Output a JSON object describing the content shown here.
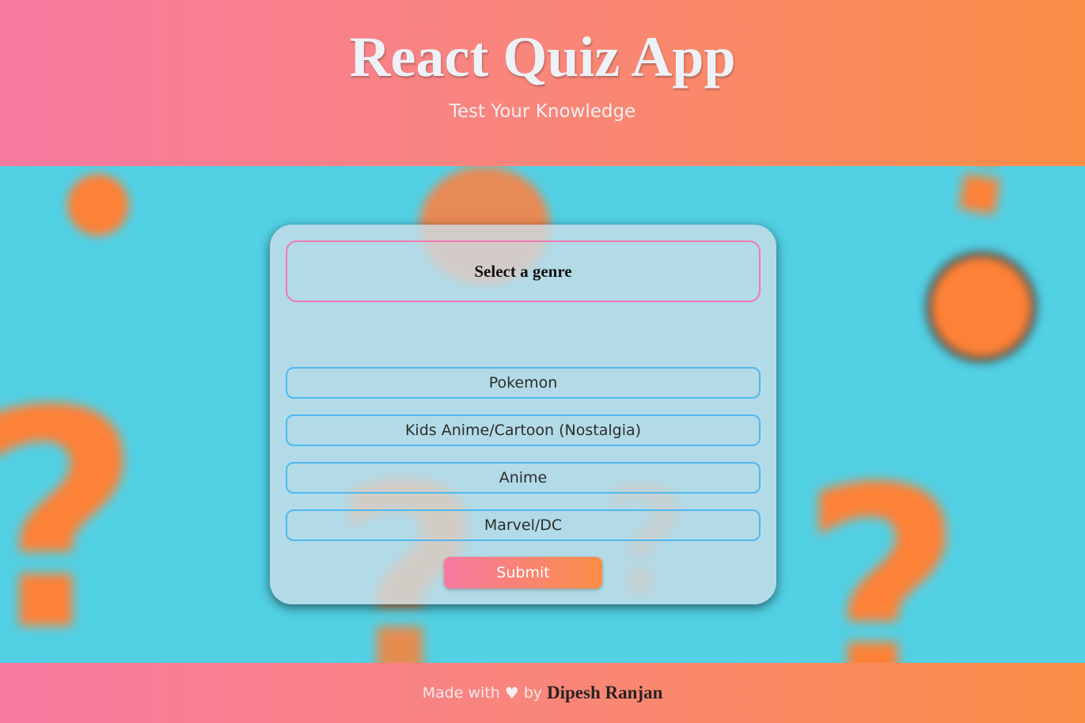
{
  "header": {
    "title": "React Quiz App",
    "subtitle": "Test Your Knowledge"
  },
  "quiz": {
    "prompt": "Select a genre",
    "options": [
      {
        "label": "Pokemon"
      },
      {
        "label": "Kids Anime/Cartoon (Nostalgia)"
      },
      {
        "label": "Anime"
      },
      {
        "label": "Marvel/DC"
      }
    ],
    "submit_label": "Submit"
  },
  "footer": {
    "made_with": "Made with",
    "heart_icon": "heart-icon",
    "by": "by",
    "author": "Dipesh Ranjan"
  },
  "colors": {
    "gradient_start": "#f779a1",
    "gradient_end": "#fb8d45",
    "background": "#52d0e4",
    "accent_orange": "#fd8137",
    "option_border": "#4fb8ef",
    "prompt_border": "#f279b0"
  }
}
